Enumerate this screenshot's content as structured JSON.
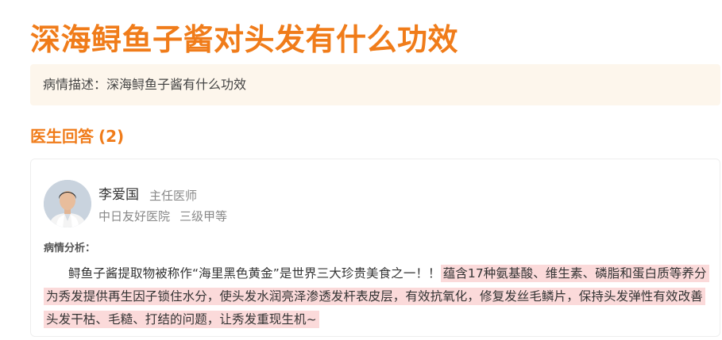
{
  "question": {
    "title": "深海鲟鱼子酱对头发有什么功效",
    "description_label": "病情描述：",
    "description": "深海鲟鱼子酱有什么功效"
  },
  "answers": {
    "heading": "医生回答",
    "count": "(2)"
  },
  "answer_card": {
    "doctor_name": "李爱国",
    "doctor_title": "主任医师",
    "hospital": "中日友好医院",
    "hospital_level": "三级甲等",
    "analysis_label": "病情分析：",
    "analysis_plain": "鲟鱼子酱提取物被称作“海里黑色黄金”是世界三大珍贵美食之一！！",
    "analysis_highlight": "蕴含17种氨基酸、维生素、磷脂和蛋白质等养分为秀发提供再生因子锁住水分，使头发水润亮泽渗透发杆表皮层，有效抗氧化，修复发丝毛鳞片，保持头发弹性有效改善头发干枯、毛糙、打结的问题，让秀发重现生机~"
  },
  "colors": {
    "accent": "#f07c1a",
    "description_bg": "#fdf6ec",
    "highlight_bg": "#fbdada"
  }
}
